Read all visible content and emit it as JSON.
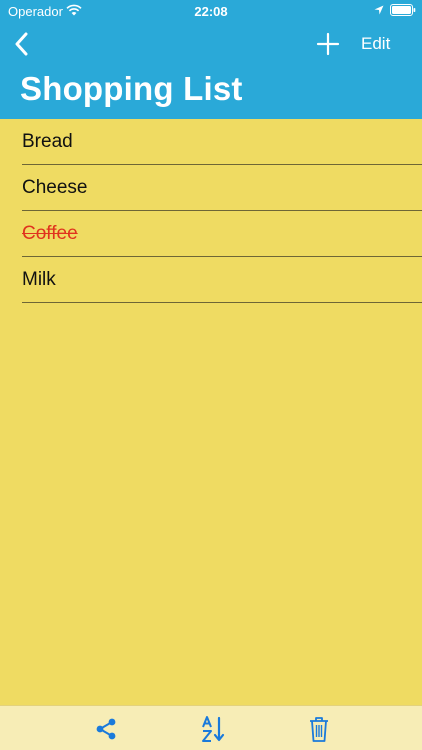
{
  "status_bar": {
    "carrier": "Operador",
    "time": "22:08"
  },
  "nav": {
    "title": "Shopping List",
    "edit_label": "Edit",
    "back_icon": "chevron-left-icon",
    "add_icon": "plus-icon"
  },
  "list": {
    "items": [
      {
        "label": "Bread",
        "done": false
      },
      {
        "label": "Cheese",
        "done": false
      },
      {
        "label": "Coffee",
        "done": true
      },
      {
        "label": "Milk",
        "done": false
      }
    ]
  },
  "toolbar": {
    "icons": [
      "share-icon",
      "sort-az-icon",
      "trash-icon"
    ]
  },
  "colors": {
    "header": "#2AA9D8",
    "background": "#EFDB62",
    "toolbar": "#F7EDB6",
    "accent": "#1A7ADB",
    "done_text": "#E0331E"
  }
}
